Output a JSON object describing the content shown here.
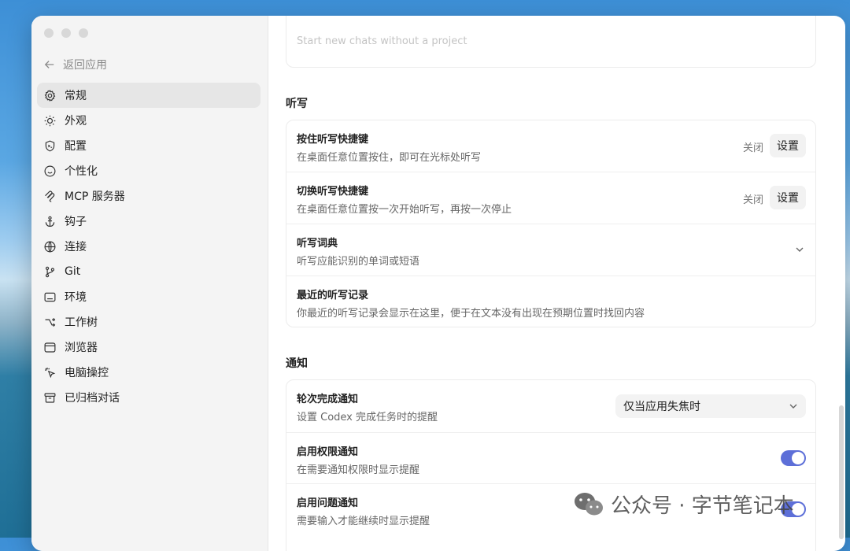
{
  "sidebar": {
    "back_label": "返回应用",
    "items": [
      {
        "label": "常规",
        "icon": "gear-icon",
        "active": true
      },
      {
        "label": "外观",
        "icon": "sun-icon"
      },
      {
        "label": "配置",
        "icon": "config-shield-icon"
      },
      {
        "label": "个性化",
        "icon": "smile-icon"
      },
      {
        "label": "MCP 服务器",
        "icon": "mcp-icon"
      },
      {
        "label": "钩子",
        "icon": "anchor-icon"
      },
      {
        "label": "连接",
        "icon": "globe-icon"
      },
      {
        "label": "Git",
        "icon": "git-branch-icon"
      },
      {
        "label": "环境",
        "icon": "monitor-icon"
      },
      {
        "label": "工作树",
        "icon": "worktree-icon"
      },
      {
        "label": "浏览器",
        "icon": "browser-icon"
      },
      {
        "label": "电脑操控",
        "icon": "cursor-click-icon"
      },
      {
        "label": "已归档对话",
        "icon": "archive-icon"
      }
    ]
  },
  "top_card": {
    "faded_text": "Start new chats without a project"
  },
  "dictation": {
    "title": "听写",
    "rows": [
      {
        "title": "按住听写快捷键",
        "desc": "在桌面任意位置按住，即可在光标处听写",
        "state": "关闭",
        "button": "设置"
      },
      {
        "title": "切换听写快捷键",
        "desc": "在桌面任意位置按一次开始听写，再按一次停止",
        "state": "关闭",
        "button": "设置"
      },
      {
        "title": "听写词典",
        "desc": "听写应能识别的单词或短语"
      },
      {
        "title": "最近的听写记录",
        "desc": "你最近的听写记录会显示在这里，便于在文本没有出现在预期位置时找回内容"
      }
    ]
  },
  "notifications": {
    "title": "通知",
    "rows": [
      {
        "title": "轮次完成通知",
        "desc": "设置 Codex 完成任务时的提醒",
        "select_value": "仅当应用失焦时"
      },
      {
        "title": "启用权限通知",
        "desc": "在需要通知权限时显示提醒",
        "enabled": true
      },
      {
        "title": "启用问题通知",
        "desc": "需要输入才能继续时显示提醒",
        "enabled": true
      }
    ]
  },
  "watermark": {
    "text": "公众号 · 字节笔记本"
  },
  "colors": {
    "toggle_on": "#5d6fd8",
    "sidebar_bg": "#f4f4f4"
  }
}
